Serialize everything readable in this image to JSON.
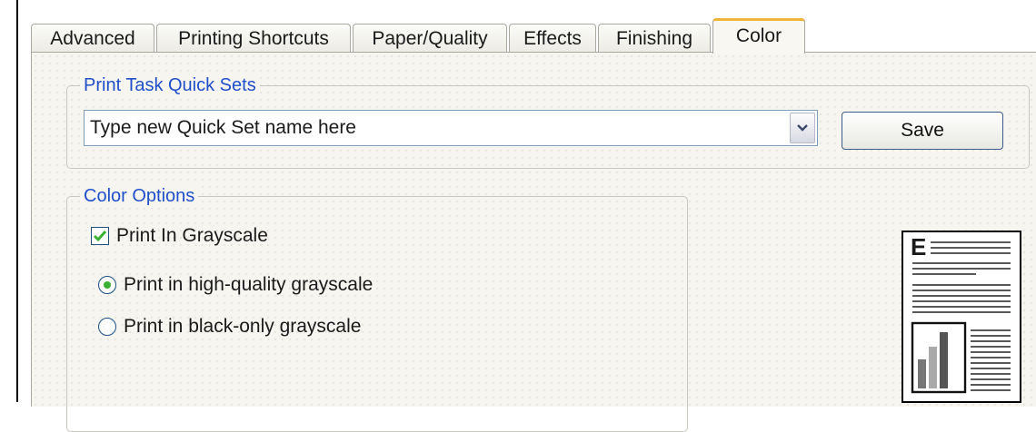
{
  "tabs": [
    {
      "label": "Advanced"
    },
    {
      "label": "Printing Shortcuts"
    },
    {
      "label": "Paper/Quality"
    },
    {
      "label": "Effects"
    },
    {
      "label": "Finishing"
    },
    {
      "label": "Color",
      "active": true
    }
  ],
  "quick_sets": {
    "legend": "Print Task Quick Sets",
    "input_value": "Type new Quick Set name here",
    "save_label": "Save"
  },
  "color_options": {
    "legend": "Color Options",
    "grayscale_checkbox": {
      "label": "Print In Grayscale",
      "checked": true
    },
    "radios": [
      {
        "label": "Print in high-quality grayscale",
        "selected": true
      },
      {
        "label": "Print in black-only grayscale",
        "selected": false
      }
    ]
  },
  "preview": {
    "glyph": "E"
  },
  "colors": {
    "legend_text": "#1f4fc9",
    "active_tab_accent": "#f0b33c",
    "check_green": "#38b032"
  }
}
